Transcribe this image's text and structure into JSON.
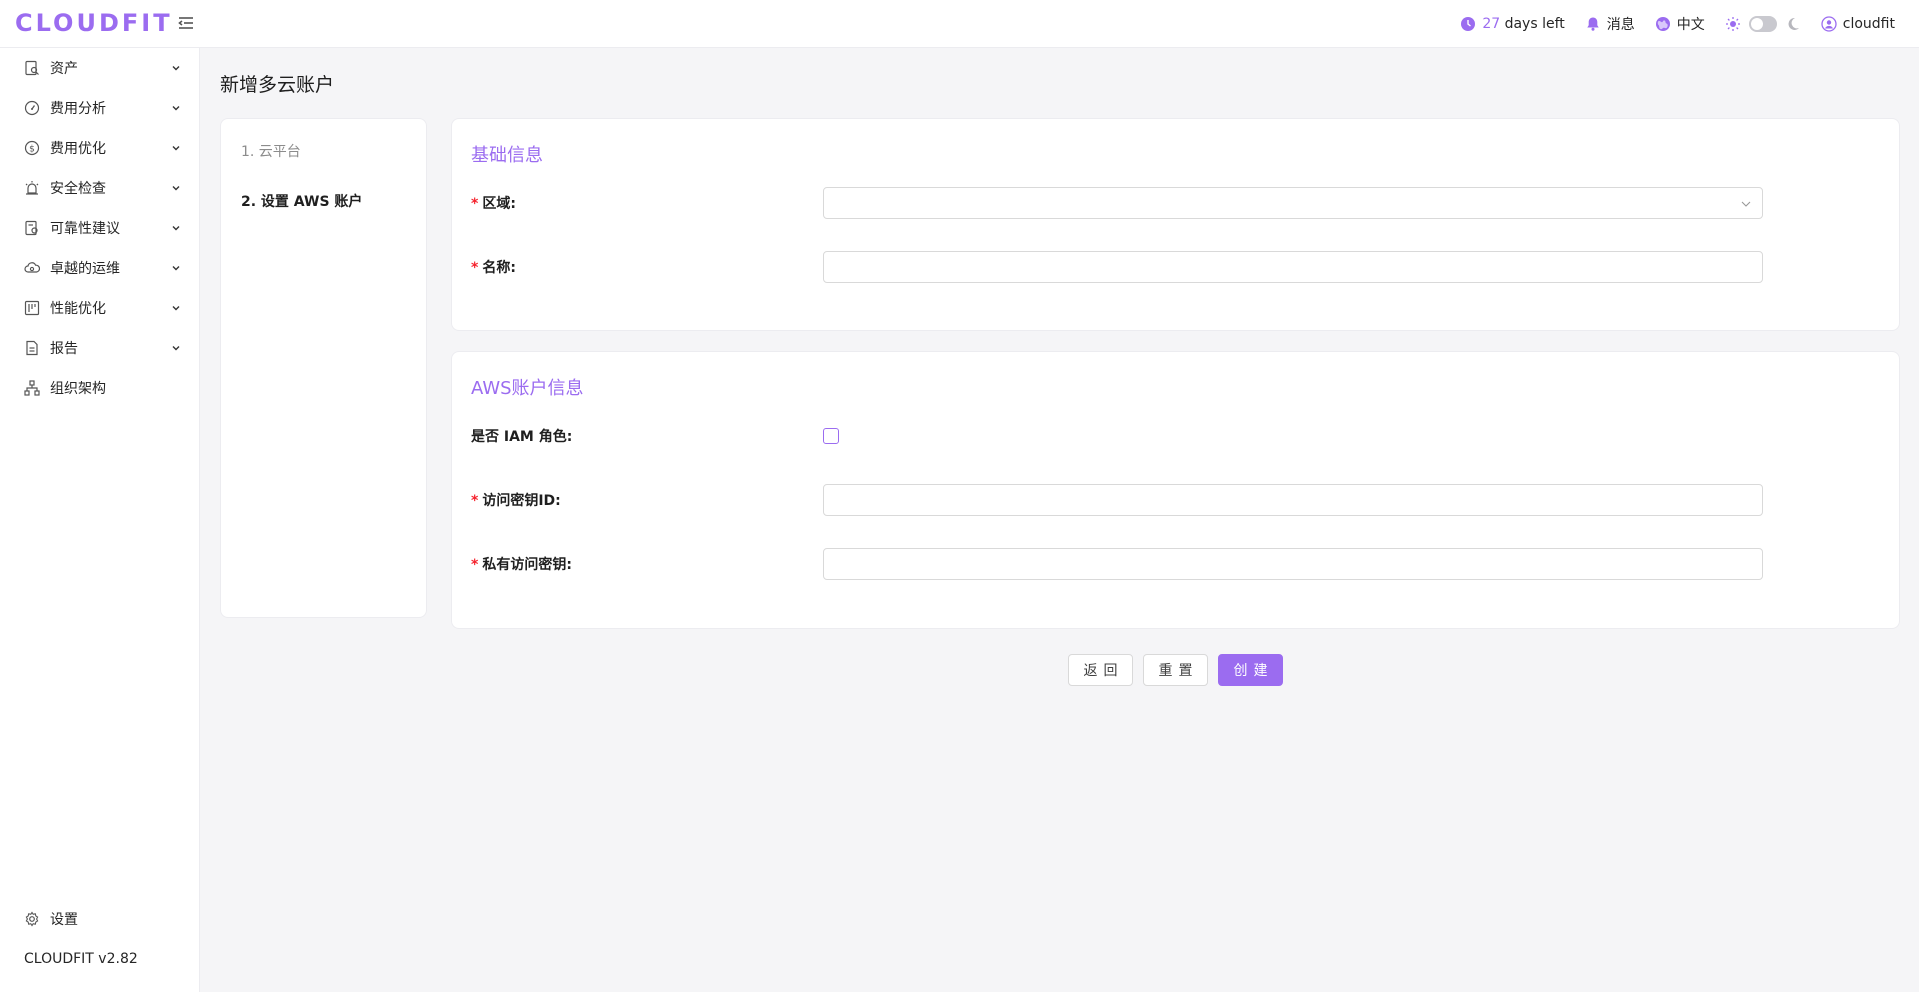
{
  "app": {
    "logo": "CLOUDFIT",
    "brand_color": "#9b6cf0"
  },
  "header": {
    "trial_days": "27",
    "trial_suffix": "days left",
    "messages": "消息",
    "language": "中文",
    "username": "cloudfit",
    "theme_mode": "light"
  },
  "sidebar": {
    "items": [
      {
        "label": "资产",
        "icon": "asset-icon",
        "expandable": true
      },
      {
        "label": "费用分析",
        "icon": "dashboard-icon",
        "expandable": true
      },
      {
        "label": "费用优化",
        "icon": "dollar-icon",
        "expandable": true
      },
      {
        "label": "安全检查",
        "icon": "alarm-icon",
        "expandable": true
      },
      {
        "label": "可靠性建议",
        "icon": "reliability-icon",
        "expandable": true
      },
      {
        "label": "卓越的运维",
        "icon": "cloud-sync-icon",
        "expandable": true
      },
      {
        "label": "性能优化",
        "icon": "performance-icon",
        "expandable": true
      },
      {
        "label": "报告",
        "icon": "report-icon",
        "expandable": true
      },
      {
        "label": "组织架构",
        "icon": "org-chart-icon",
        "expandable": false
      }
    ],
    "settings": "设置",
    "version": "CLOUDFIT v2.82"
  },
  "page": {
    "title": "新增多云账户",
    "steps": [
      "1. 云平台",
      "2. 设置 AWS 账户"
    ],
    "active_step": 2
  },
  "basic_info": {
    "title": "基础信息",
    "region_label": "区域:",
    "region_value": "",
    "name_label": "名称:",
    "name_value": ""
  },
  "aws_info": {
    "title": "AWS账户信息",
    "iam_role_label": "是否 IAM 角色:",
    "iam_role_checked": false,
    "access_key_label": "访问密钥ID:",
    "access_key_value": "",
    "secret_key_label": "私有访问密钥:",
    "secret_key_value": ""
  },
  "actions": {
    "back": "返回",
    "reset": "重置",
    "create": "创建"
  }
}
